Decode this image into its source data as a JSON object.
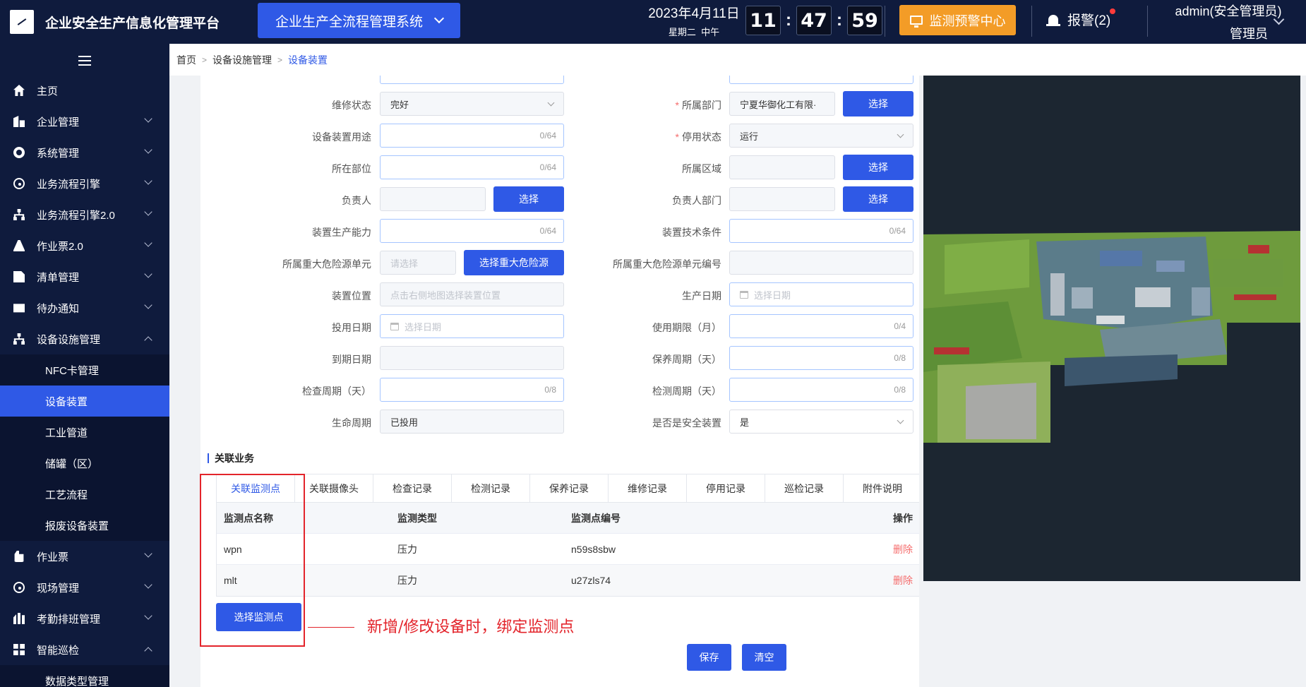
{
  "header": {
    "app_title": "企业安全生产信息化管理平台",
    "system_select": "企业生产全流程管理系统",
    "date": "2023年4月11日",
    "weekday": "星期二",
    "period": "中午",
    "clock": {
      "h": "11",
      "m": "47",
      "s": "59"
    },
    "monitor_center": "监测预警中心",
    "alarm_label": "报警(2)",
    "user_name": "admin(安全管理员)",
    "user_role": "管理员"
  },
  "sidebar": {
    "items": [
      {
        "label": "主页",
        "icon": "home-icon"
      },
      {
        "label": "企业管理",
        "icon": "building-icon"
      },
      {
        "label": "系统管理",
        "icon": "gear-icon"
      },
      {
        "label": "业务流程引擎",
        "icon": "flow-icon"
      },
      {
        "label": "业务流程引擎2.0",
        "icon": "tree-icon"
      },
      {
        "label": "作业票2.0",
        "icon": "ticket-icon"
      },
      {
        "label": "清单管理",
        "icon": "doc-icon"
      },
      {
        "label": "待办通知",
        "icon": "mail-icon"
      },
      {
        "label": "设备设施管理",
        "icon": "tree-icon"
      },
      {
        "label": "作业票",
        "icon": "kettle-icon"
      },
      {
        "label": "现场管理",
        "icon": "flow-icon"
      },
      {
        "label": "考勤排班管理",
        "icon": "chart-icon"
      },
      {
        "label": "智能巡检",
        "icon": "grid-icon"
      }
    ],
    "device_subitems": [
      "NFC卡管理",
      "设备装置",
      "工业管道",
      "储罐（区）",
      "工艺流程",
      "报废设备装置"
    ],
    "inspection_subitems": [
      "数据类型管理"
    ]
  },
  "breadcrumb": {
    "home": "首页",
    "parent": "设备设施管理",
    "current": "设备装置"
  },
  "form": {
    "maintenance_status": {
      "label": "维修状态",
      "value": "完好"
    },
    "department": {
      "label": "所属部门",
      "value": "宁夏华御化工有限·"
    },
    "usage": {
      "label": "设备装置用途",
      "count": "0/64"
    },
    "stop_status": {
      "label": "停用状态",
      "value": "运行"
    },
    "position": {
      "label": "所在部位",
      "count": "0/64"
    },
    "area": {
      "label": "所属区域"
    },
    "owner": {
      "label": "负责人"
    },
    "owner_dept": {
      "label": "负责人部门"
    },
    "capacity": {
      "label": "装置生产能力",
      "count": "0/64"
    },
    "tech_conditions": {
      "label": "装置技术条件",
      "count": "0/64"
    },
    "hazard_unit": {
      "label": "所属重大危险源单元",
      "placeholder": "请选择"
    },
    "hazard_btn": "选择重大危险源",
    "hazard_code": {
      "label": "所属重大危险源单元编号"
    },
    "location": {
      "label": "装置位置",
      "placeholder": "点击右侧地图选择装置位置"
    },
    "production_date": {
      "label": "生产日期",
      "placeholder": "选择日期"
    },
    "commission_date": {
      "label": "投用日期",
      "placeholder": "选择日期"
    },
    "service_life": {
      "label": "使用期限（月）",
      "count": "0/4"
    },
    "expiry_date": {
      "label": "到期日期"
    },
    "maintenance_cycle": {
      "label": "保养周期（天）",
      "count": "0/8"
    },
    "inspection_cycle": {
      "label": "检查周期（天）",
      "count": "0/8"
    },
    "testing_cycle": {
      "label": "检测周期（天）",
      "count": "0/8"
    },
    "lifecycle": {
      "label": "生命周期",
      "value": "已投用"
    },
    "safety_device": {
      "label": "是否是安全装置",
      "value": "是"
    },
    "select_label": "选择"
  },
  "related": {
    "title": "关联业务",
    "tabs": [
      "关联监测点",
      "关联摄像头",
      "检查记录",
      "检测记录",
      "保养记录",
      "维修记录",
      "停用记录",
      "巡检记录",
      "附件说明"
    ],
    "columns": [
      "监测点名称",
      "监测类型",
      "监测点编号",
      "操作"
    ],
    "rows": [
      {
        "name": "wpn",
        "type": "压力",
        "code": "n59s8sbw",
        "action": "删除"
      },
      {
        "name": "mlt",
        "type": "压力",
        "code": "u27zls74",
        "action": "删除"
      }
    ],
    "select_btn": "选择监测点",
    "save_btn": "保存",
    "clear_btn": "清空"
  },
  "annotation": "新增/修改设备时，绑定监测点"
}
